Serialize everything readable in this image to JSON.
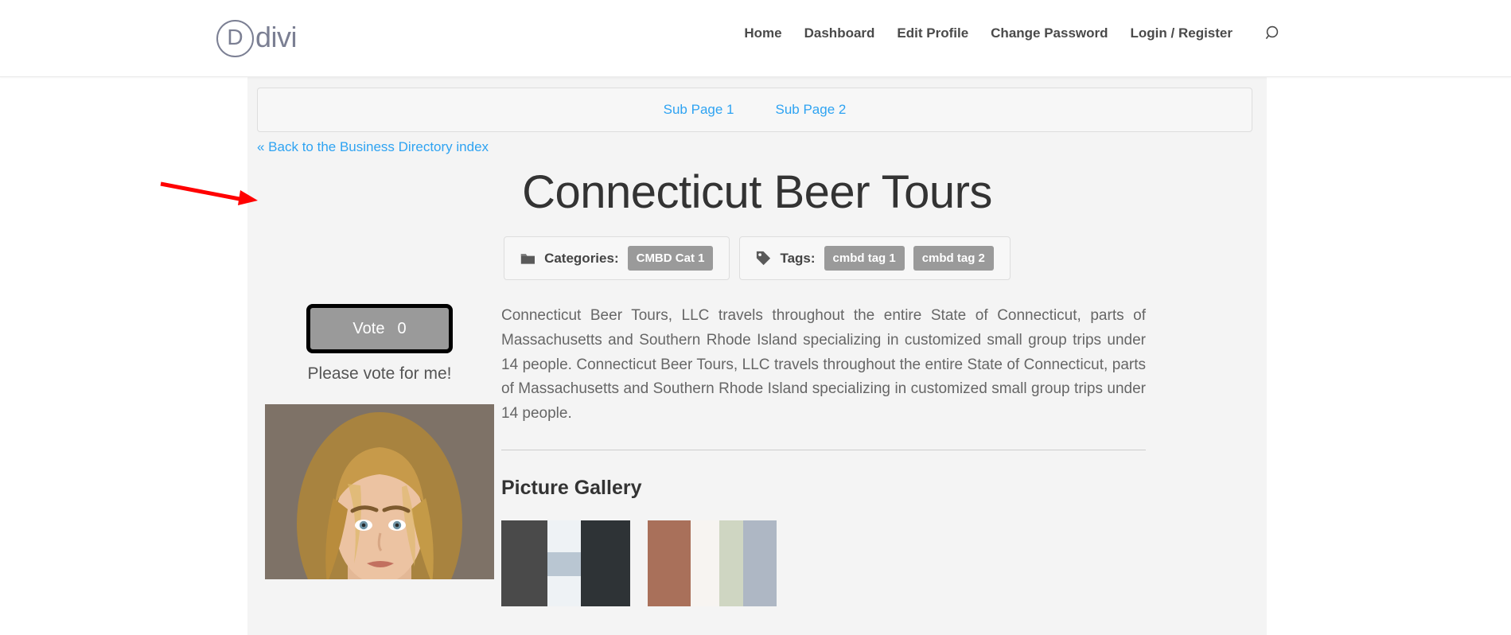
{
  "header": {
    "logo": {
      "mark": "D",
      "text": "divi",
      "icon": "divi-logo-icon"
    },
    "nav": [
      {
        "label": "Home"
      },
      {
        "label": "Dashboard"
      },
      {
        "label": "Edit Profile"
      },
      {
        "label": "Change Password"
      },
      {
        "label": "Login / Register"
      }
    ],
    "search_icon": "search-icon"
  },
  "annotation": {
    "arrow_color": "#ff0000",
    "points_to": "sub-page-navigation-box"
  },
  "subpages": {
    "links": [
      {
        "label": "Sub Page 1"
      },
      {
        "label": "Sub Page 2"
      }
    ]
  },
  "listing": {
    "back_link": "« Back to the Business Directory index",
    "title": "Connecticut Beer Tours",
    "categories": {
      "icon": "folder-icon",
      "label": "Categories:",
      "chips": [
        "CMBD Cat 1"
      ]
    },
    "tags": {
      "icon": "tag-icon",
      "label": "Tags:",
      "chips": [
        "cmbd tag 1",
        "cmbd tag 2"
      ]
    },
    "vote": {
      "button_label": "Vote",
      "count": "0",
      "caption": "Please vote for me!"
    },
    "photo_alt": "listing-main-photo",
    "description": "Connecticut Beer Tours, LLC travels throughout the entire State of Connecticut, parts of Massachusetts and Southern Rhode Island specializing in customized small group trips under 14 people. Connecticut Beer Tours, LLC travels throughout the entire State of Connecticut, parts of Massachusetts and Southern Rhode Island specializing in customized small group trips under 14 people.",
    "gallery": {
      "heading": "Picture Gallery",
      "thumbs": [
        "gallery-thumb-1",
        "gallery-thumb-2"
      ]
    }
  },
  "colors": {
    "link_blue": "#2ea3f2",
    "chip_gray": "#9a9a9a",
    "content_bg": "#f4f4f4",
    "box_bg": "#f7f7f7",
    "border": "#dddddd",
    "text_dark": "#333333",
    "text_body": "#666666",
    "annotation_red": "#ff0000"
  }
}
